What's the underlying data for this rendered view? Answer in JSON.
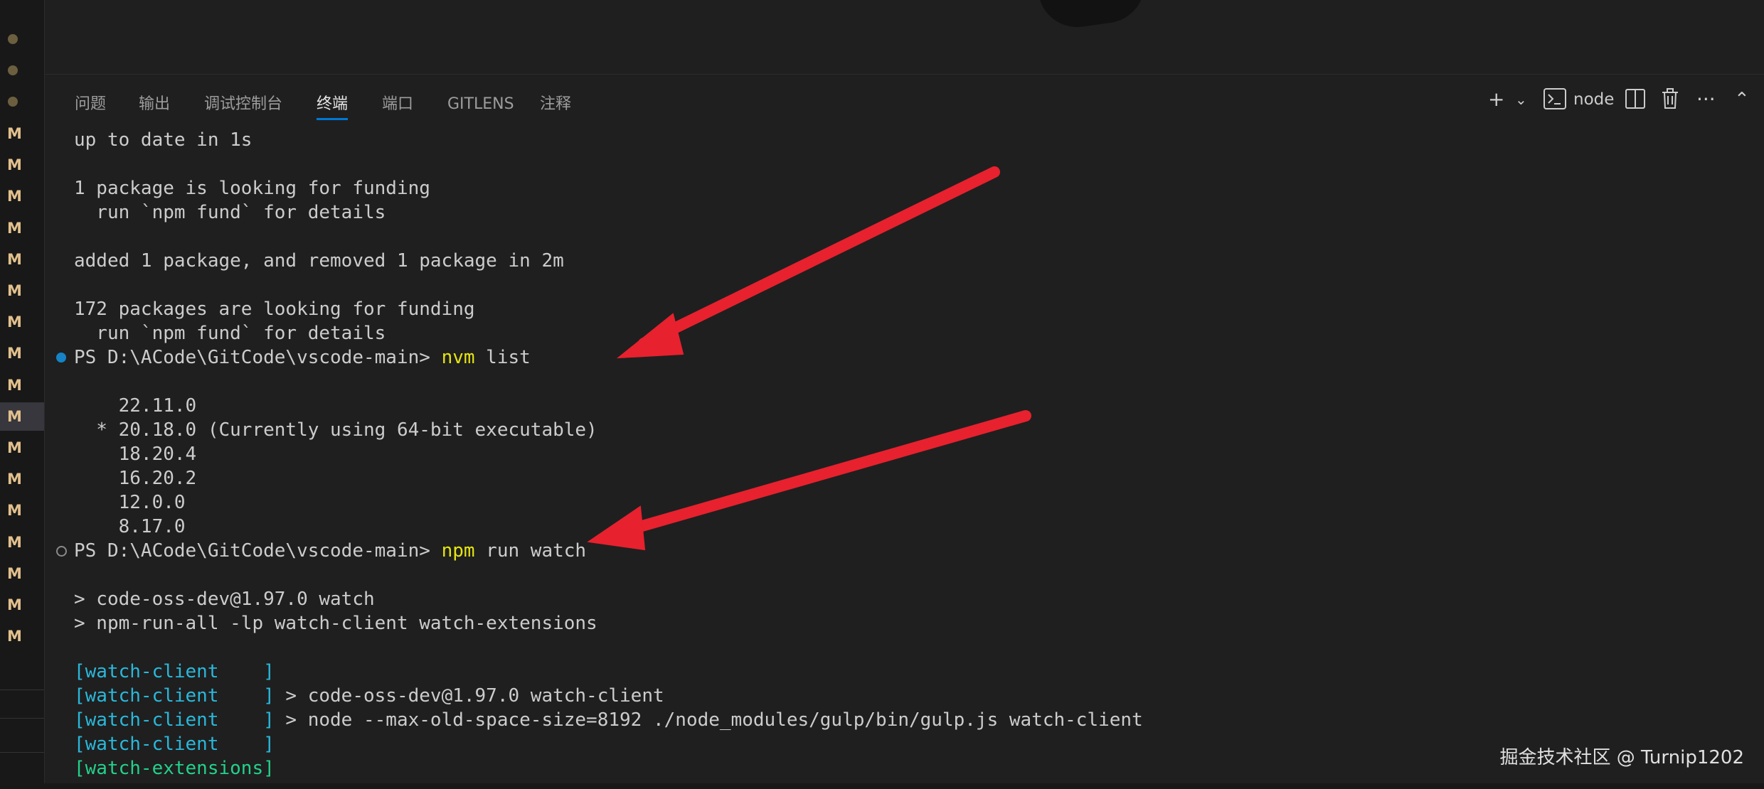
{
  "tabs": [
    {
      "label": "问题"
    },
    {
      "label": "输出"
    },
    {
      "label": "调试控制台"
    },
    {
      "label": "终端"
    },
    {
      "label": "端口"
    },
    {
      "label": "GITLENS"
    },
    {
      "label": "注释"
    }
  ],
  "active_tab": "终端",
  "toolbar": {
    "plus_icon": "plus-icon",
    "dropdown_icon": "chevron-down-icon",
    "terminal_label": "node",
    "icons": [
      "terminal-icon",
      "split-icon",
      "trash-icon",
      "more-icon",
      "chevron-up-icon"
    ]
  },
  "gutter": {
    "dots": 3,
    "markers": [
      "M",
      "M",
      "M",
      "M",
      "M",
      "M",
      "M",
      "M",
      "M",
      "M",
      "M",
      "M",
      "M",
      "M",
      "M",
      "M",
      "M"
    ]
  },
  "terminal": {
    "lines": [
      {
        "text": "up to date in 1s"
      },
      {
        "text": ""
      },
      {
        "text": "1 package is looking for funding"
      },
      {
        "text": "  run `npm fund` for details"
      },
      {
        "text": ""
      },
      {
        "text": "added 1 package, and removed 1 package in 2m"
      },
      {
        "text": ""
      },
      {
        "text": "172 packages are looking for funding"
      },
      {
        "text": "  run `npm fund` for details"
      },
      {
        "prompt": "PS D:\\ACode\\GitCode\\vscode-main> ",
        "cmd": "nvm",
        "args": " list",
        "marker": "filled"
      },
      {
        "text": ""
      },
      {
        "text": "    22.11.0"
      },
      {
        "text": "  * 20.18.0 (Currently using 64-bit executable)"
      },
      {
        "text": "    18.20.4"
      },
      {
        "text": "    16.20.2"
      },
      {
        "text": "    12.0.0"
      },
      {
        "text": "    8.17.0"
      },
      {
        "prompt": "PS D:\\ACode\\GitCode\\vscode-main> ",
        "cmd": "npm",
        "args": " run watch",
        "marker": "hollow"
      },
      {
        "text": ""
      },
      {
        "text": "> code-oss-dev@1.97.0 watch"
      },
      {
        "text": "> npm-run-all -lp watch-client watch-extensions"
      },
      {
        "text": ""
      },
      {
        "tag": "[watch-client    ]",
        "color": "cyan",
        "rest": ""
      },
      {
        "tag": "[watch-client    ]",
        "color": "cyan",
        "rest": " > code-oss-dev@1.97.0 watch-client"
      },
      {
        "tag": "[watch-client    ]",
        "color": "cyan",
        "rest": " > node --max-old-space-size=8192 ./node_modules/gulp/bin/gulp.js watch-client"
      },
      {
        "tag": "[watch-client    ]",
        "color": "cyan",
        "rest": ""
      },
      {
        "tag": "[watch-extensions]",
        "color": "green",
        "rest": ""
      }
    ]
  },
  "watermark": "掘金技术社区 @ Turnip1202",
  "colors": {
    "arrow": "#e8212e",
    "accent": "#0078d4",
    "prompt_cmd": "#e5e510",
    "tag_cyan": "#29b8db",
    "tag_green": "#23d18b"
  }
}
